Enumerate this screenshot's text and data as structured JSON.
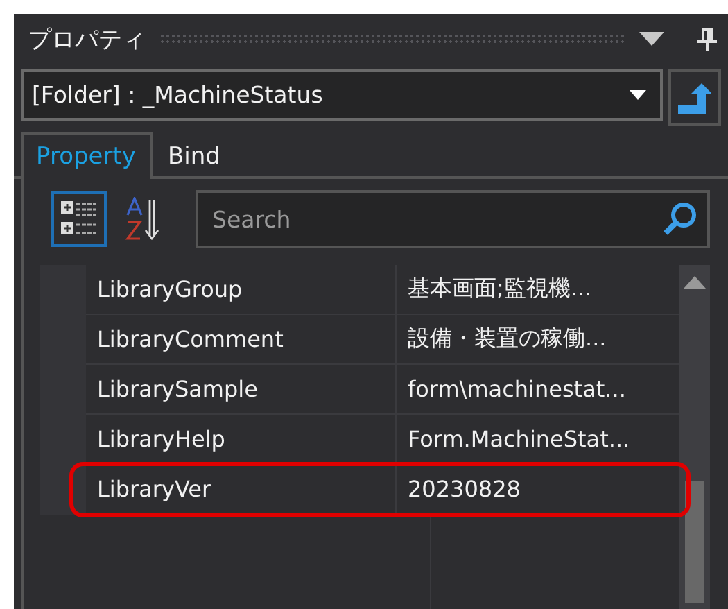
{
  "panel": {
    "title": "プロパティ"
  },
  "object_selector": {
    "value": "[Folder] : _MachineStatus"
  },
  "tabs": [
    {
      "label": "Property",
      "selected": true
    },
    {
      "label": "Bind",
      "selected": false
    }
  ],
  "toolbar": {
    "categorized": {
      "selected": true
    },
    "alphabetical": {
      "selected": false
    }
  },
  "search": {
    "placeholder": "Search"
  },
  "properties": [
    {
      "name": "LibraryGroup",
      "value": "基本画面;監視機...",
      "highlighted": false
    },
    {
      "name": "LibraryComment",
      "value": "設備・装置の稼働...",
      "highlighted": false
    },
    {
      "name": "LibrarySample",
      "value": "form\\machinestat...",
      "highlighted": false
    },
    {
      "name": "LibraryHelp",
      "value": "Form.MachineStat...",
      "highlighted": false
    },
    {
      "name": "LibraryVer",
      "value": "20230828",
      "highlighted": true
    }
  ]
}
